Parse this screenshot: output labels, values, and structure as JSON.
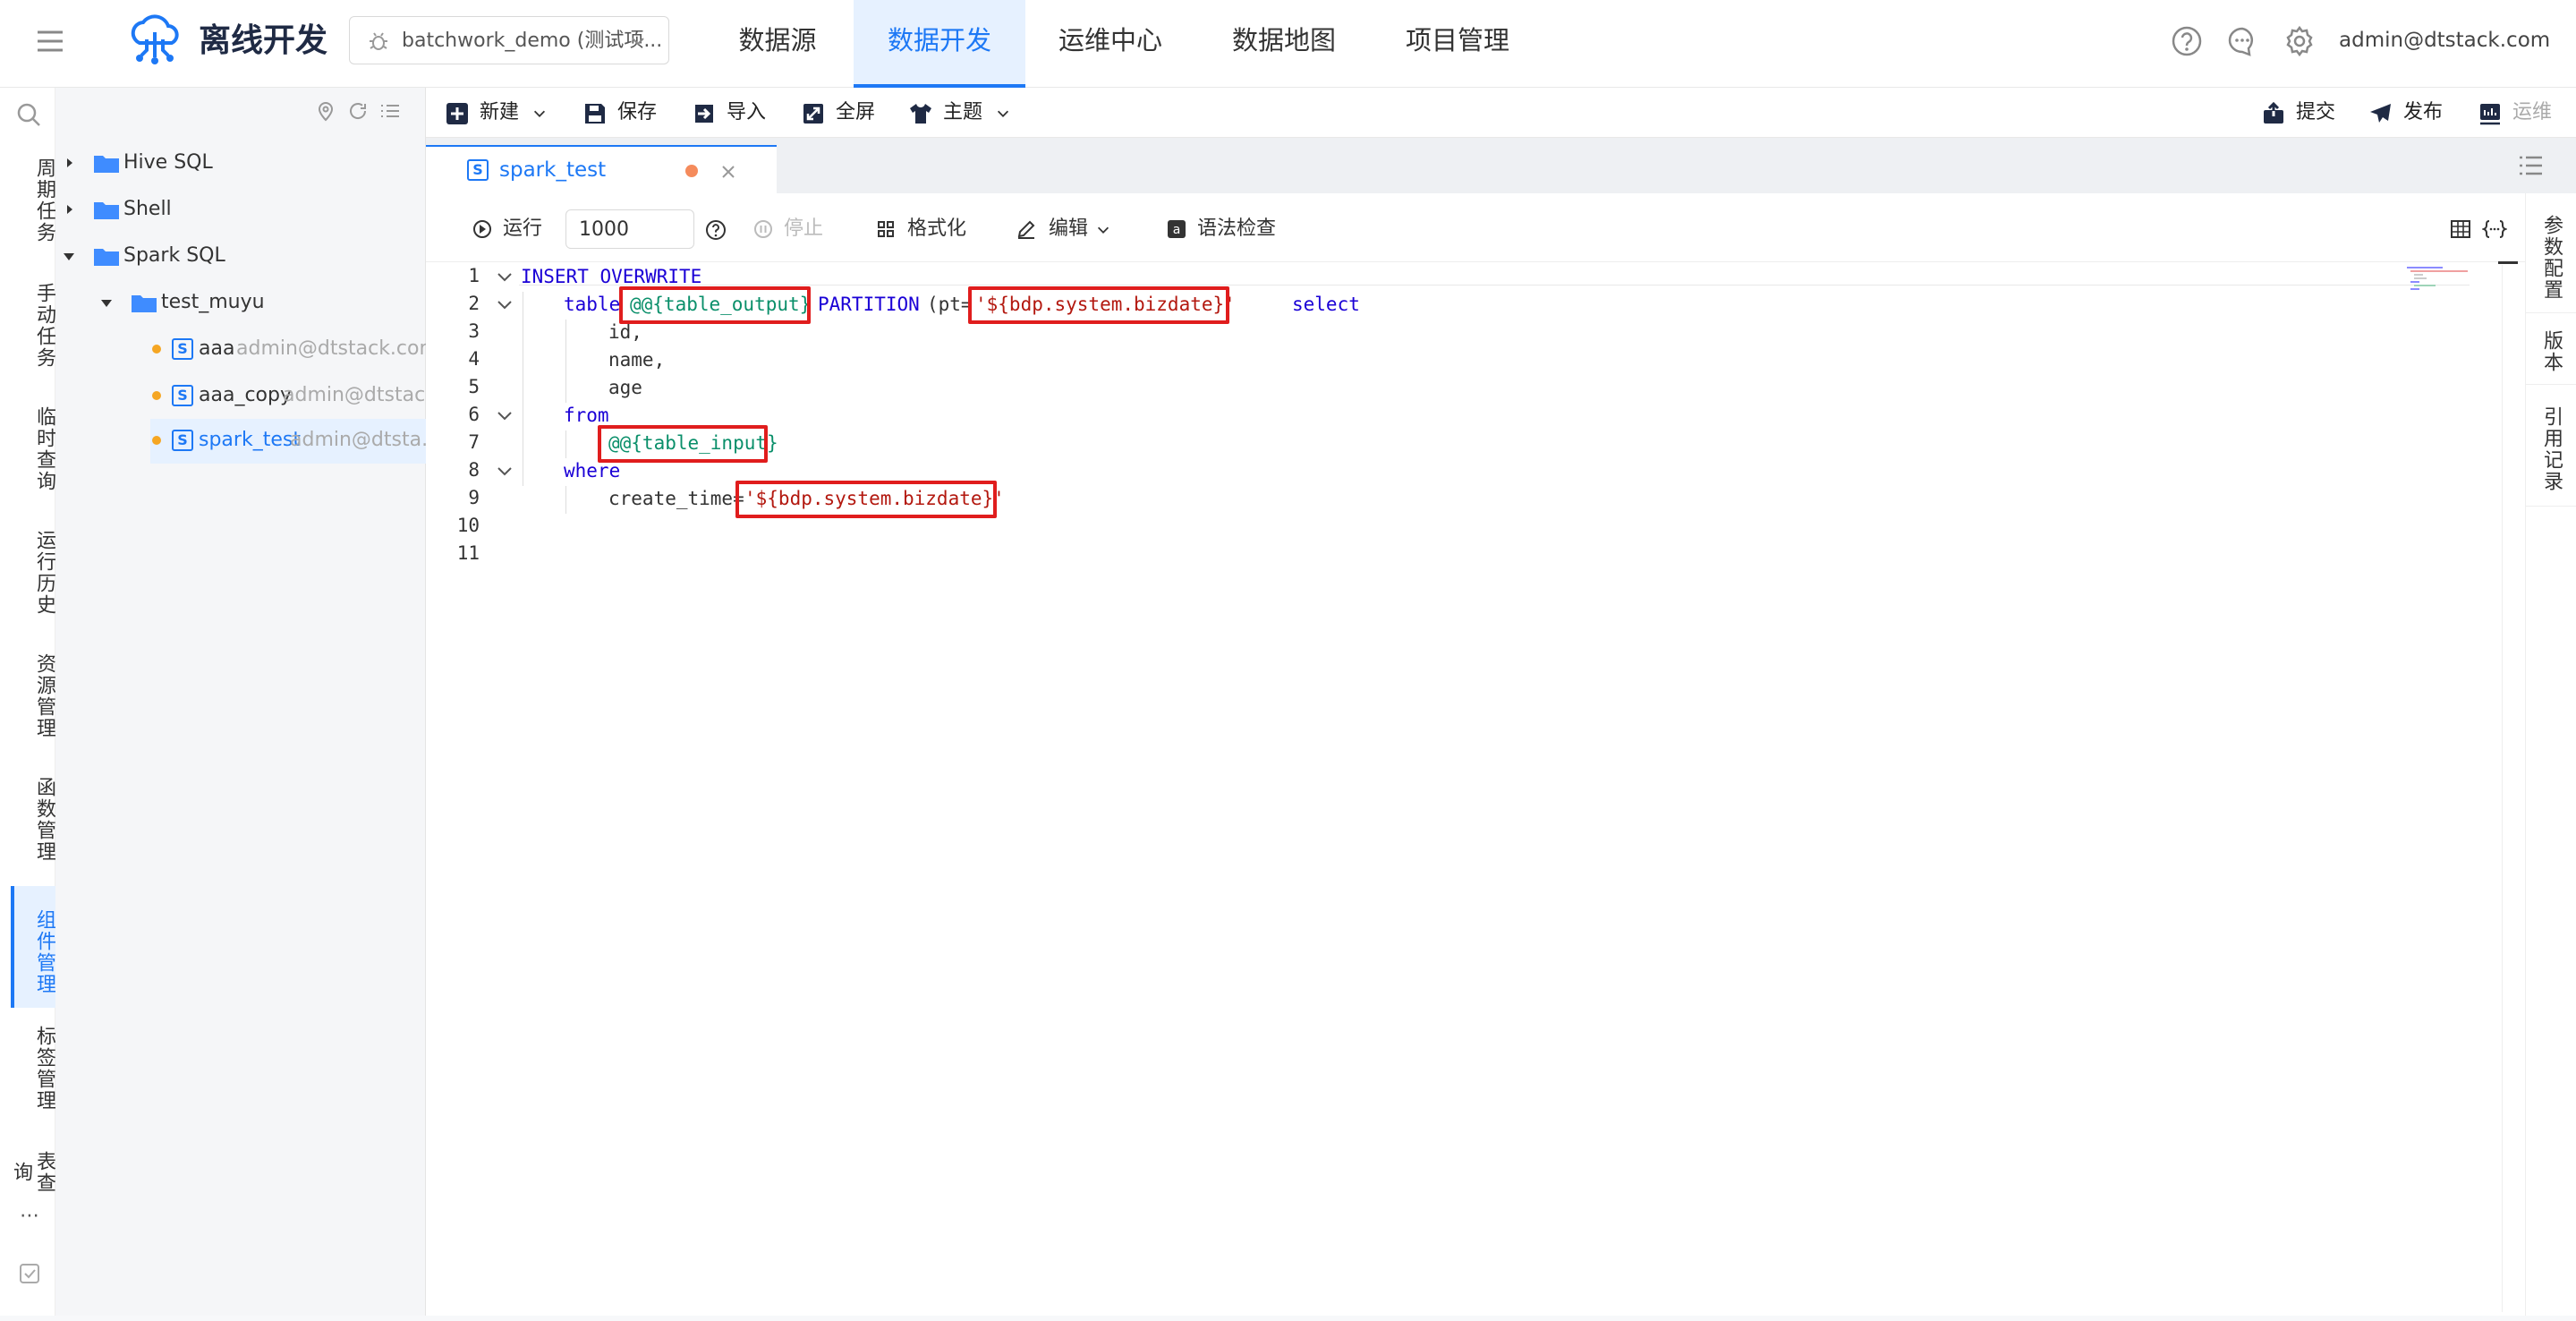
{
  "header": {
    "app_name": "离线开发",
    "project": "batchwork_demo (测试项...",
    "nav": [
      "数据源",
      "数据开发",
      "运维中心",
      "数据地图",
      "项目管理"
    ],
    "active_nav": "数据开发",
    "user": "admin@dtstack.com"
  },
  "rail": {
    "items": [
      "周期任务",
      "手动任务",
      "临时查询",
      "运行历史",
      "资源管理",
      "函数管理",
      "组件管理",
      "标签管理",
      "表查询"
    ],
    "active": "组件管理",
    "more": "⋯"
  },
  "tree": {
    "folders": [
      {
        "label": "Hive SQL"
      },
      {
        "label": "Shell"
      },
      {
        "label": "Spark SQL"
      },
      {
        "label": "test_muyu"
      }
    ],
    "files": [
      {
        "name": "aaa",
        "owner": "admin@dtstack.com..."
      },
      {
        "name": "aaa_copy",
        "owner": "admin@dtstac..."
      },
      {
        "name": "spark_test",
        "owner": "admin@dtsta..."
      }
    ],
    "file_badge": "S"
  },
  "toolbar": {
    "new": "新建",
    "save": "保存",
    "import": "导入",
    "fullscreen": "全屏",
    "theme": "主题",
    "submit": "提交",
    "publish": "发布",
    "ops": "运维"
  },
  "tabs": [
    {
      "label": "spark_test",
      "badge": "S"
    }
  ],
  "editor_toolbar": {
    "run": "运行",
    "limit_value": "1000",
    "stop": "停止",
    "format": "格式化",
    "edit": "编辑",
    "syntax_check": "语法检查"
  },
  "right_panel": [
    "参数配置",
    "版本",
    "引用记录"
  ],
  "code": {
    "line_numbers": [
      "1",
      "2",
      "3",
      "4",
      "5",
      "6",
      "7",
      "8",
      "9",
      "10",
      "11"
    ],
    "l1": "INSERT OVERWRITE",
    "l2_kw": "table",
    "l2_var": "@@{table_output}",
    "l2_kw2": "PARTITION",
    "l2_paren": "(pt=",
    "l2_str": "'${bdp.system.bizdate}'",
    "l2_select": "select",
    "l3": "id,",
    "l4": "name,",
    "l5": "age",
    "l6": "from",
    "l7_var": "@@{table_input}",
    "l8": "where",
    "l9_col": "create_time=",
    "l9_str": "'${bdp.system.bizdate}'"
  },
  "colors": {
    "accent": "#1d78f5",
    "keyword": "#1a00d6",
    "variable": "#0a8f6a",
    "string": "#b3180f",
    "highlight_box": "#e01d1d",
    "modified_dot": "#f5a623"
  }
}
